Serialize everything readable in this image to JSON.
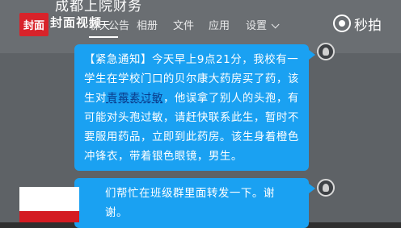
{
  "header": {
    "group_name": "成都上院财务",
    "tabs": [
      {
        "label": "聊天"
      },
      {
        "label": "公告"
      },
      {
        "label": "相册"
      },
      {
        "label": "文件"
      },
      {
        "label": "应用"
      },
      {
        "label": "设置"
      }
    ]
  },
  "watermarks": {
    "left_logo": "封面",
    "left_text": "封面视频",
    "right_text": "秒拍"
  },
  "messages": [
    {
      "lines": [
        "【紧急通知】今天早上9点21分，我校有一",
        "学生在学校门口的贝尔康大药房买了药，该",
        [
          "生对",
          "青霉素过敏",
          "，他误拿了别人的头孢，有"
        ],
        "可能对头孢过敏，请赶快联系此生，暂时不",
        "要服用药品，立即到此药房。该生身着橙色",
        "冲锋衣，带着银色眼镜，男生。"
      ]
    },
    {
      "lines": [
        "们帮忙在班级群里面转发一下。谢",
        "谢。"
      ]
    }
  ],
  "colors": {
    "bubble": "#1aa1f2",
    "background": "#5e6266",
    "logo_red": "#d8232a"
  }
}
